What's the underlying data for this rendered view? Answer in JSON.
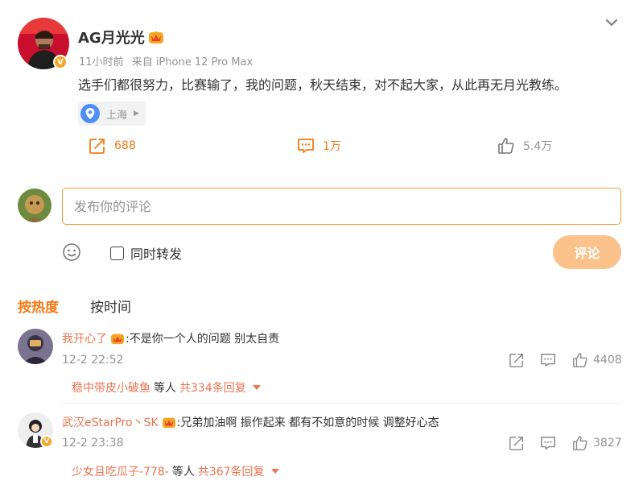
{
  "post": {
    "username": "AG月光光",
    "time": "11小时前",
    "source": "来自 iPhone 12 Pro Max",
    "text": "选手们都很努力，比赛输了，我的问题，秋天结束，对不起大家，从此再无月光教练。",
    "location": "上海",
    "repost_count": "688",
    "comment_count": "1万",
    "like_count": "5.4万"
  },
  "compose": {
    "placeholder": "发布你的评论",
    "repost_label": "同时转发",
    "submit_label": "评论"
  },
  "sort_tabs": [
    {
      "label": "按热度",
      "active": true
    },
    {
      "label": "按时间",
      "active": false
    }
  ],
  "comments": [
    {
      "username": "我开心了",
      "text": ":不是你一个人的问题 别太自责",
      "time": "12-2 22:52",
      "likes": "4408",
      "reply_user": "稳中带皮小破鱼",
      "reply_mid": "等人",
      "reply_count": "共334条回复"
    },
    {
      "username": "武汉eStarPro丶SK",
      "text": ":兄弟加油啊 振作起来 都有不如意的时候 调整好心态",
      "time": "12-2 23:38",
      "likes": "3827",
      "reply_user": "少女且吃瓜子-778-",
      "reply_mid": "等人",
      "reply_count": "共367条回复"
    }
  ],
  "colors": {
    "accent": "#f57b16",
    "username_link": "#eb7350",
    "muted": "#939393",
    "submit_bg": "#fbc38b",
    "input_border": "#f39b30"
  },
  "icons": {
    "chevron": "chevron-down-icon",
    "location": "location-icon",
    "repost": "repost-icon",
    "comment": "comment-icon",
    "like": "like-icon",
    "emoji": "emoji-icon",
    "share": "share-icon",
    "verified": "verified-badge-icon"
  }
}
